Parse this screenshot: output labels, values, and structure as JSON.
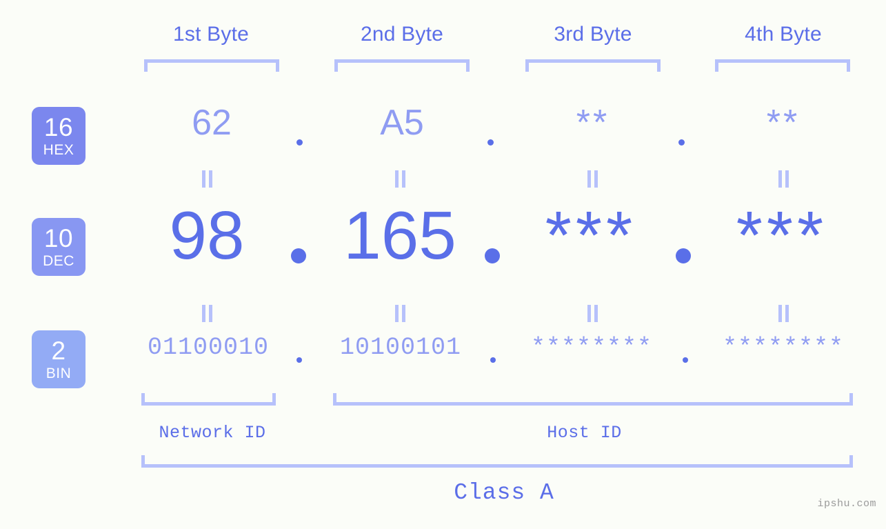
{
  "meta": {
    "watermark": "ipshu.com",
    "background_color": "#fbfdf8",
    "accent_color": "#5a6fe8",
    "muted_accent_color": "#8f9cf2",
    "bracket_color": "#b6c1fb"
  },
  "byte_headers": [
    {
      "label": "1st Byte"
    },
    {
      "label": "2nd Byte"
    },
    {
      "label": "3rd Byte"
    },
    {
      "label": "4th Byte"
    }
  ],
  "bases": [
    {
      "num": "16",
      "unit": "HEX",
      "color": "#7b87ee"
    },
    {
      "num": "10",
      "unit": "DEC",
      "color": "#8897f2"
    },
    {
      "num": "2",
      "unit": "BIN",
      "color": "#93abf5"
    }
  ],
  "rows": {
    "hex": {
      "base_label": "HEX",
      "values": [
        "62",
        "A5",
        "**",
        "**"
      ],
      "masked": [
        false,
        false,
        true,
        true
      ]
    },
    "dec": {
      "base_label": "DEC",
      "values": [
        "98",
        "165",
        "***",
        "***"
      ],
      "masked": [
        false,
        false,
        true,
        true
      ]
    },
    "bin": {
      "base_label": "BIN",
      "values": [
        "01100010",
        "10100101",
        "********",
        "********"
      ],
      "masked": [
        false,
        false,
        true,
        true
      ]
    }
  },
  "separators": {
    "dot": ".",
    "equals": "="
  },
  "footer": {
    "network_id_label": "Network ID",
    "host_id_label": "Host ID",
    "class_label": "Class A"
  }
}
